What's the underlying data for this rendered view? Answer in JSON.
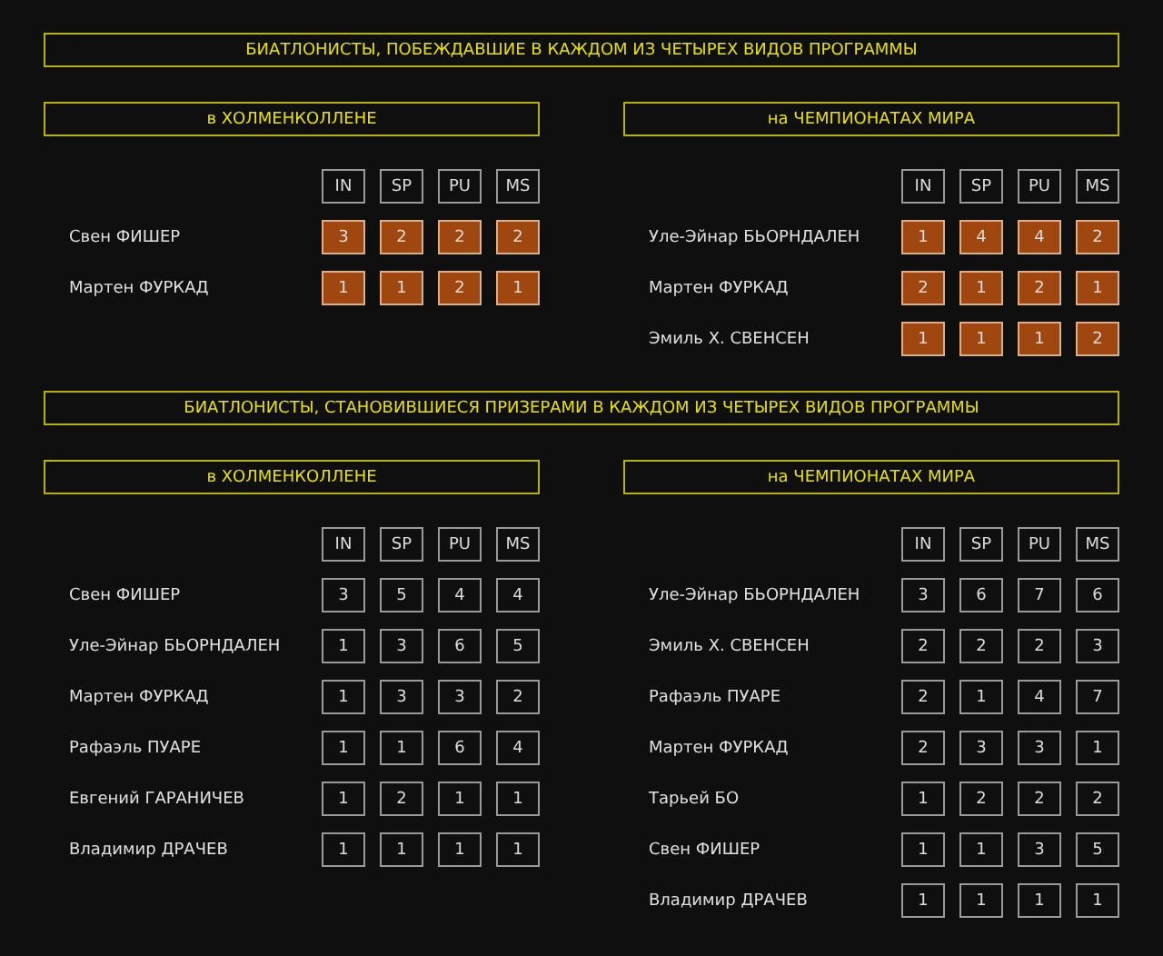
{
  "sections": [
    {
      "title": "БИАТЛОНИСТЫ, ПОБЕЖДАВШИЕ В КАЖДОМ ИЗ ЧЕТЫРЕХ ВИДОВ ПРОГРАММЫ",
      "highlighted": true,
      "panels": [
        {
          "subtitle": "в ХОЛМЕНКОЛЛЕНЕ",
          "columns": [
            "IN",
            "SP",
            "PU",
            "MS"
          ],
          "rows": [
            {
              "name": "Свен ФИШЕР",
              "values": [
                "3",
                "2",
                "2",
                "2"
              ]
            },
            {
              "name": "Мартен ФУРКАД",
              "values": [
                "1",
                "1",
                "2",
                "1"
              ]
            }
          ]
        },
        {
          "subtitle": "на ЧЕМПИОНАТАХ МИРА",
          "columns": [
            "IN",
            "SP",
            "PU",
            "MS"
          ],
          "rows": [
            {
              "name": "Уле-Эйнар БЬОРНДАЛЕН",
              "values": [
                "1",
                "4",
                "4",
                "2"
              ]
            },
            {
              "name": "Мартен ФУРКАД",
              "values": [
                "2",
                "1",
                "2",
                "1"
              ]
            },
            {
              "name": "Эмиль Х. СВЕНСЕН",
              "values": [
                "1",
                "1",
                "1",
                "2"
              ]
            }
          ]
        }
      ]
    },
    {
      "title": "БИАТЛОНИСТЫ, СТАНОВИВШИЕСЯ ПРИЗЕРАМИ В КАЖДОМ ИЗ ЧЕТЫРЕХ ВИДОВ ПРОГРАММЫ",
      "highlighted": false,
      "panels": [
        {
          "subtitle": "в ХОЛМЕНКОЛЛЕНЕ",
          "columns": [
            "IN",
            "SP",
            "PU",
            "MS"
          ],
          "rows": [
            {
              "name": "Свен ФИШЕР",
              "values": [
                "3",
                "5",
                "4",
                "4"
              ]
            },
            {
              "name": "Уле-Эйнар БЬОРНДАЛЕН",
              "values": [
                "1",
                "3",
                "6",
                "5"
              ]
            },
            {
              "name": "Мартен ФУРКАД",
              "values": [
                "1",
                "3",
                "3",
                "2"
              ]
            },
            {
              "name": "Рафаэль ПУАРЕ",
              "values": [
                "1",
                "1",
                "6",
                "4"
              ]
            },
            {
              "name": "Евгений ГАРАНИЧЕВ",
              "values": [
                "1",
                "2",
                "1",
                "1"
              ]
            },
            {
              "name": "Владимир ДРАЧЕВ",
              "values": [
                "1",
                "1",
                "1",
                "1"
              ]
            }
          ]
        },
        {
          "subtitle": "на ЧЕМПИОНАТАХ МИРА",
          "columns": [
            "IN",
            "SP",
            "PU",
            "MS"
          ],
          "rows": [
            {
              "name": "Уле-Эйнар БЬОРНДАЛЕН",
              "values": [
                "3",
                "6",
                "7",
                "6"
              ]
            },
            {
              "name": "Эмиль Х. СВЕНСЕН",
              "values": [
                "2",
                "2",
                "2",
                "3"
              ]
            },
            {
              "name": "Рафаэль ПУАРЕ",
              "values": [
                "2",
                "1",
                "4",
                "7"
              ]
            },
            {
              "name": "Мартен ФУРКАД",
              "values": [
                "2",
                "3",
                "3",
                "1"
              ]
            },
            {
              "name": "Тарьей БО",
              "values": [
                "1",
                "2",
                "2",
                "2"
              ]
            },
            {
              "name": "Свен ФИШЕР",
              "values": [
                "1",
                "1",
                "3",
                "5"
              ]
            },
            {
              "name": "Владимир ДРАЧЕВ",
              "values": [
                "1",
                "1",
                "1",
                "1"
              ]
            }
          ]
        }
      ]
    }
  ]
}
